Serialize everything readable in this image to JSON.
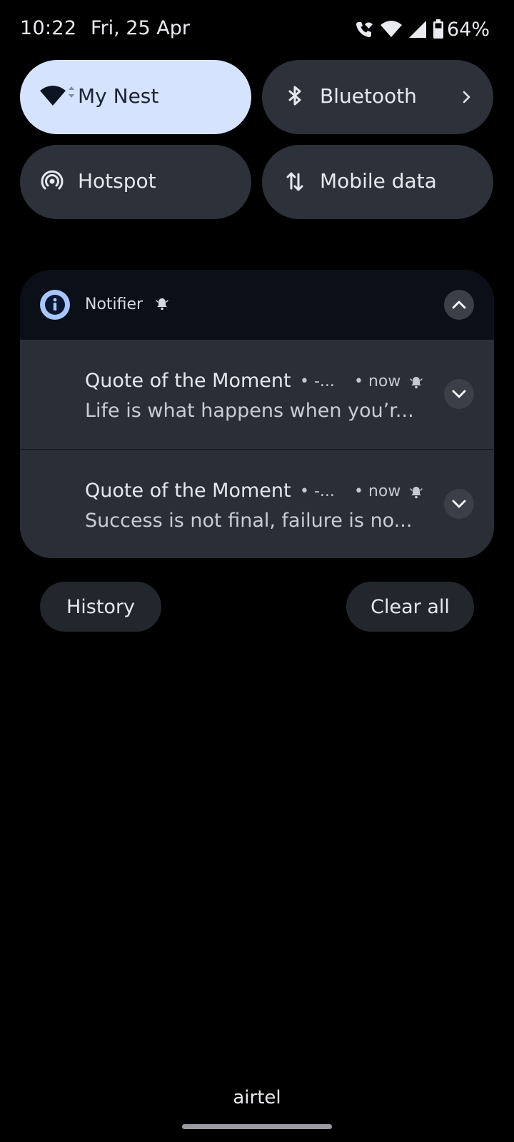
{
  "status_bar": {
    "time": "10:22",
    "date": "Fri, 25 Apr",
    "battery_percent": "64%",
    "icons": [
      "wifi-calling-icon",
      "wifi-icon",
      "signal-icon",
      "battery-icon"
    ]
  },
  "quick_tiles": [
    {
      "label": "My Nest",
      "icon": "wifi-icon",
      "active": true
    },
    {
      "label": "Bluetooth",
      "icon": "bluetooth-icon",
      "active": false,
      "has_chevron": true
    },
    {
      "label": "Hotspot",
      "icon": "hotspot-icon",
      "active": false
    },
    {
      "label": "Mobile data",
      "icon": "mobile-data-icon",
      "active": false
    }
  ],
  "notification_group": {
    "app_name": "Notifier",
    "app_icon": "info-icon",
    "items": [
      {
        "title": "Quote of the Moment",
        "subtext": "• -...",
        "time": "• now",
        "text": "Life is what happens when you’r..."
      },
      {
        "title": "Quote of the Moment",
        "subtext": "• -...",
        "time": "• now",
        "text": "Success is not final, failure is no..."
      }
    ]
  },
  "actions": {
    "history_label": "History",
    "clear_all_label": "Clear all"
  },
  "carrier": "airtel",
  "colors": {
    "background": "#000000",
    "tile": "#2c313a",
    "tile_active": "#d6e3ff",
    "card": "#2a2e37",
    "card_header": "#0b0f17",
    "accent": "#a9c6ff"
  }
}
